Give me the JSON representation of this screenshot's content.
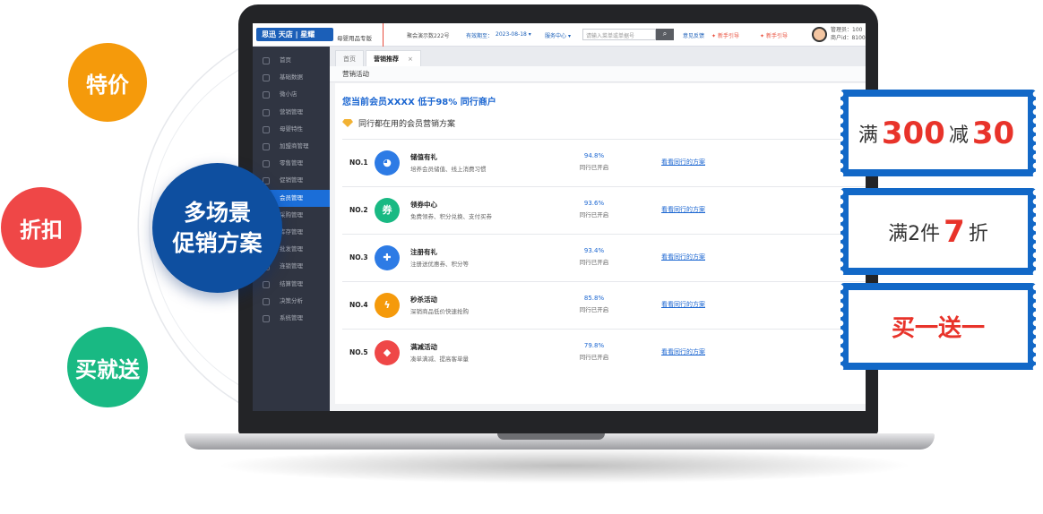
{
  "bubbles": {
    "special_price": "特价",
    "discount": "折扣",
    "buy_gift": "买就送",
    "multi_line1": "多场景",
    "multi_line2": "促销方案"
  },
  "topbar": {
    "logo": "思迅 天店 | 星耀",
    "logo_sub": "母婴用品专版",
    "store": "聚会演示数222号",
    "expiry_label": "有效期至：",
    "expiry_date": "2023-08-18",
    "service_center": "服务中心",
    "search_placeholder": "请输入菜单或单据号",
    "feedback": "意见反馈",
    "guide1": "新手引导",
    "guide2": "新手引导",
    "user_line1": "管理员：100",
    "user_line2": "商户id：8100"
  },
  "sidebar": {
    "items": [
      {
        "label": "首页"
      },
      {
        "label": "基础数据"
      },
      {
        "label": "微小店"
      },
      {
        "label": "营销管理"
      },
      {
        "label": "母婴特性"
      },
      {
        "label": "加盟商管理"
      },
      {
        "label": "零售管理"
      },
      {
        "label": "促销管理"
      },
      {
        "label": "会员管理"
      },
      {
        "label": "采购管理"
      },
      {
        "label": "库存管理"
      },
      {
        "label": "批发管理"
      },
      {
        "label": "连锁管理"
      },
      {
        "label": "结算管理"
      },
      {
        "label": "决策分析"
      },
      {
        "label": "系统管理"
      }
    ],
    "active_index": 8
  },
  "tabs": [
    {
      "label": "首页"
    },
    {
      "label": "营销推荐",
      "close": "×"
    }
  ],
  "panel": {
    "header": "营销活动",
    "hero": "您当前会员XXXX 低于98% 同行商户",
    "subtitle": "同行都在用的会员营销方案",
    "rows": [
      {
        "rank": "NO.1",
        "name": "储值有礼",
        "desc": "培养会员储值、线上消费习惯",
        "pct": "94.8%",
        "status": "同行已开启",
        "link": "看看同行的方案",
        "color": "#2d7be5",
        "icon": "piggy-bank-icon"
      },
      {
        "rank": "NO.2",
        "name": "领券中心",
        "desc": "免费领券、积分兑换、支付买券",
        "pct": "93.6%",
        "status": "同行已开启",
        "link": "看看同行的方案",
        "color": "#19b983",
        "icon": "coupon-icon"
      },
      {
        "rank": "NO.3",
        "name": "注册有礼",
        "desc": "注册送优惠券、积分等",
        "pct": "93.4%",
        "status": "同行已开启",
        "link": "看看同行的方案",
        "color": "#2d7be5",
        "icon": "user-add-icon"
      },
      {
        "rank": "NO.4",
        "name": "秒杀活动",
        "desc": "深销商品低价快速抢购",
        "pct": "85.8%",
        "status": "同行已开启",
        "link": "看看同行的方案",
        "color": "#f59a0b",
        "icon": "lightning-icon"
      },
      {
        "rank": "NO.5",
        "name": "满减活动",
        "desc": "凑单满减、提高客单量",
        "pct": "79.8%",
        "status": "同行已开启",
        "link": "看看同行的方案",
        "color": "#ef4747",
        "icon": "tag-icon"
      }
    ]
  },
  "coupons": {
    "c1_pre": "满",
    "c1_num1": "300",
    "c1_mid": "减",
    "c1_num2": "30",
    "c2_pre": "满2件",
    "c2_num": "7",
    "c2_post": "折",
    "c3_text": "买一送一"
  }
}
